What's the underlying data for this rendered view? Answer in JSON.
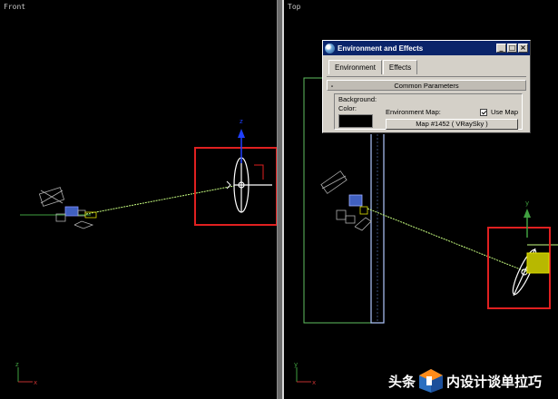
{
  "viewports": {
    "front": {
      "label": "Front"
    },
    "top": {
      "label": "Top"
    }
  },
  "dialog": {
    "title": "Environment and Effects",
    "window_buttons": {
      "minimize": "_",
      "maximize": "□",
      "close": "×"
    },
    "tabs": [
      {
        "label": "Environment"
      },
      {
        "label": "Effects"
      }
    ],
    "rollout": {
      "toggle": "-",
      "title": "Common Parameters"
    },
    "background": {
      "group_label": "Background:",
      "color_label": "Color:",
      "color_value": "#000000",
      "env_map_label": "Environment Map:",
      "use_map_label": "Use Map",
      "use_map_checked": true,
      "map_button": "Map #1452  ( VRaySky )"
    }
  },
  "watermark": {
    "text_left": "头条",
    "text_right": "内设计谈单拉巧"
  },
  "colors": {
    "selection_box": "#e02020",
    "object_wire": "#ffffff",
    "sun_line": "#c8ff80",
    "ground_line": "#40a040",
    "gizmo_blue": "#2040ff",
    "gizmo_yellow": "#e0e000",
    "camera_wire": "#b0b0b0",
    "panel_outline": "#60c060"
  }
}
